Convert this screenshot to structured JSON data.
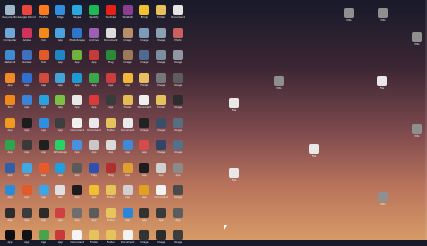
{
  "desktop": {
    "icons": [
      {
        "name": "Recycle Bin",
        "icon": "recycle-bin-icon",
        "color": "#9fb7c9"
      },
      {
        "name": "Google Chrome",
        "icon": "chrome-icon",
        "color": "#e8453c"
      },
      {
        "name": "Firefox",
        "icon": "firefox-icon",
        "color": "#ff7a1a"
      },
      {
        "name": "Edge",
        "icon": "edge-icon",
        "color": "#2f8ee0"
      },
      {
        "name": "Skype",
        "icon": "skype-icon",
        "color": "#29a8e0"
      },
      {
        "name": "Spotify",
        "icon": "spotify-icon",
        "color": "#1db954"
      },
      {
        "name": "YouTube",
        "icon": "youtube-icon",
        "color": "#e62117"
      },
      {
        "name": "WinRAR",
        "icon": "winrar-icon",
        "color": "#8b3d8f"
      },
      {
        "name": "Emoji",
        "icon": "emoji-icon",
        "color": "#f3c12e"
      },
      {
        "name": "Folder",
        "icon": "folder-icon",
        "color": "#e8c15a"
      },
      {
        "name": "Document",
        "icon": "document-icon",
        "color": "#e4e4e4"
      },
      {
        "name": "Computer",
        "icon": "computer-icon",
        "color": "#6fa7d6"
      },
      {
        "name": "Adobe",
        "icon": "adobe-icon",
        "color": "#d1345b"
      },
      {
        "name": "VLC",
        "icon": "vlc-icon",
        "color": "#f28a1a"
      },
      {
        "name": "App",
        "icon": "app-icon",
        "color": "#4aa3df"
      },
      {
        "name": "PhotoScape",
        "icon": "photo-icon",
        "color": "#2c77c9"
      },
      {
        "name": "Archive",
        "icon": "archive-icon",
        "color": "#9c5fb5"
      },
      {
        "name": "Document",
        "icon": "document-icon",
        "color": "#dcdcdc"
      },
      {
        "name": "Image",
        "icon": "image-icon",
        "color": "#b88d6a"
      },
      {
        "name": "Image",
        "icon": "image-icon",
        "color": "#7a9cb8"
      },
      {
        "name": "Image",
        "icon": "image-icon",
        "color": "#8ca0b3"
      },
      {
        "name": "Photo",
        "icon": "photo-icon",
        "color": "#c86060"
      },
      {
        "name": "Network",
        "icon": "network-icon",
        "color": "#3d8bd0"
      },
      {
        "name": "Games",
        "icon": "game-icon",
        "color": "#3f6fbf"
      },
      {
        "name": "Tool",
        "icon": "tool-icon",
        "color": "#e05a2a"
      },
      {
        "name": "App",
        "icon": "app-icon",
        "color": "#1e88c7"
      },
      {
        "name": "App",
        "icon": "app-icon",
        "color": "#70b33c"
      },
      {
        "name": "App",
        "icon": "app-icon",
        "color": "#c63a3a"
      },
      {
        "name": "Flag",
        "icon": "flag-icon",
        "color": "#2a8a3a"
      },
      {
        "name": "Image",
        "icon": "image-icon",
        "color": "#9b7a5a"
      },
      {
        "name": "Image",
        "icon": "image-icon",
        "color": "#4e6a8f"
      },
      {
        "name": "Image",
        "icon": "image-icon",
        "color": "#7b8f9e"
      },
      {
        "name": "Image",
        "icon": "image-icon",
        "color": "#8e97a2"
      },
      {
        "name": "App",
        "icon": "app-icon",
        "color": "#f08a24"
      },
      {
        "name": "App",
        "icon": "app-icon",
        "color": "#2f6fce"
      },
      {
        "name": "App",
        "icon": "app-icon",
        "color": "#d24a3b"
      },
      {
        "name": "App",
        "icon": "app-icon",
        "color": "#40a4d8"
      },
      {
        "name": "App",
        "icon": "app-icon",
        "color": "#1c9ad6"
      },
      {
        "name": "App",
        "icon": "app-icon",
        "color": "#3aa84a"
      },
      {
        "name": "App",
        "icon": "app-icon",
        "color": "#cc3d3d"
      },
      {
        "name": "App",
        "icon": "app-icon",
        "color": "#f1b83a"
      },
      {
        "name": "Folder",
        "icon": "folder-icon",
        "color": "#e6c060"
      },
      {
        "name": "Image",
        "icon": "image-icon",
        "color": "#777777"
      },
      {
        "name": "Image",
        "icon": "image-icon",
        "color": "#5d5d5d"
      },
      {
        "name": "Tool",
        "icon": "tool-icon",
        "color": "#ef8a18"
      },
      {
        "name": "App",
        "icon": "app-icon",
        "color": "#3a83d6"
      },
      {
        "name": "App",
        "icon": "app-icon",
        "color": "#27a1e0"
      },
      {
        "name": "App",
        "icon": "app-icon",
        "color": "#7ac043"
      },
      {
        "name": "App",
        "icon": "app-icon",
        "color": "#e8e8e8"
      },
      {
        "name": "App",
        "icon": "app-icon",
        "color": "#d93a3a"
      },
      {
        "name": "App",
        "icon": "app-icon",
        "color": "#3a3a3a"
      },
      {
        "name": "Folder",
        "icon": "folder-icon",
        "color": "#e2bd56"
      },
      {
        "name": "Document",
        "icon": "document-icon",
        "color": "#efefef"
      },
      {
        "name": "Folder",
        "icon": "folder-icon",
        "color": "#e4c35e"
      },
      {
        "name": "Image",
        "icon": "image-icon",
        "color": "#2c2c2c"
      },
      {
        "name": "App",
        "icon": "app-icon",
        "color": "#f09a1e"
      },
      {
        "name": "App",
        "icon": "app-icon",
        "color": "#1c1c1c"
      },
      {
        "name": "App",
        "icon": "app-icon",
        "color": "#2e8fe0"
      },
      {
        "name": "App",
        "icon": "app-icon",
        "color": "#3d3d3d"
      },
      {
        "name": "Document",
        "icon": "document-icon",
        "color": "#f0f0f0"
      },
      {
        "name": "Document",
        "icon": "document-icon",
        "color": "#e9e9e9"
      },
      {
        "name": "Folder",
        "icon": "folder-icon",
        "color": "#e5c25b"
      },
      {
        "name": "Document",
        "icon": "document-icon",
        "color": "#eaeaea"
      },
      {
        "name": "Image",
        "icon": "image-icon",
        "color": "#222222"
      },
      {
        "name": "Image",
        "icon": "image-icon",
        "color": "#3c4d66"
      },
      {
        "name": "Image",
        "icon": "image-icon",
        "color": "#5a6d80"
      },
      {
        "name": "App",
        "icon": "app-icon",
        "color": "#2ba64a"
      },
      {
        "name": "App",
        "icon": "app-icon",
        "color": "#3a3a3a"
      },
      {
        "name": "App",
        "icon": "app-icon",
        "color": "#1f1f1f"
      },
      {
        "name": "WhatsApp",
        "icon": "whatsapp-icon",
        "color": "#25d366"
      },
      {
        "name": "App",
        "icon": "app-icon",
        "color": "#4a8fe0"
      },
      {
        "name": "App",
        "icon": "app-icon",
        "color": "#c8c8c8"
      },
      {
        "name": "App",
        "icon": "app-icon",
        "color": "#dadada"
      },
      {
        "name": "App",
        "icon": "app-icon",
        "color": "#3f89d6"
      },
      {
        "name": "App",
        "icon": "app-icon",
        "color": "#d64a4a"
      },
      {
        "name": "Image",
        "icon": "image-icon",
        "color": "#334466"
      },
      {
        "name": "Image",
        "icon": "image-icon",
        "color": "#56708a"
      },
      {
        "name": "App",
        "icon": "app-icon",
        "color": "#2f5fa8"
      },
      {
        "name": "App",
        "icon": "app-icon",
        "color": "#3fa9e6"
      },
      {
        "name": "App",
        "icon": "app-icon",
        "color": "#e85a2a"
      },
      {
        "name": "App",
        "icon": "app-icon",
        "color": "#1ea0e0"
      },
      {
        "name": "App",
        "icon": "app-icon",
        "color": "#5a5a5a"
      },
      {
        "name": "Flag",
        "icon": "flag-icon",
        "color": "#3050b0"
      },
      {
        "name": "Flag",
        "icon": "flag-icon",
        "color": "#b03030"
      },
      {
        "name": "App",
        "icon": "app-icon",
        "color": "#e0a030"
      },
      {
        "name": "App",
        "icon": "app-icon",
        "color": "#1d1d1d"
      },
      {
        "name": "App",
        "icon": "app-icon",
        "color": "#d0d0d0"
      },
      {
        "name": "App",
        "icon": "app-icon",
        "color": "#8a8a8a"
      },
      {
        "name": "App",
        "icon": "app-icon",
        "color": "#2a8bd8"
      },
      {
        "name": "App",
        "icon": "app-icon",
        "color": "#e25a2a"
      },
      {
        "name": "App",
        "icon": "app-icon",
        "color": "#3aa6e8"
      },
      {
        "name": "App",
        "icon": "app-icon",
        "color": "#e0e0e0"
      },
      {
        "name": "App",
        "icon": "app-icon",
        "color": "#1c1c1c"
      },
      {
        "name": "App",
        "icon": "app-icon",
        "color": "#f0c030"
      },
      {
        "name": "Folder",
        "icon": "folder-icon",
        "color": "#e8c35a"
      },
      {
        "name": "App",
        "icon": "app-icon",
        "color": "#cfcfcf"
      },
      {
        "name": "App",
        "icon": "app-icon",
        "color": "#e0a020"
      },
      {
        "name": "Document",
        "icon": "document-icon",
        "color": "#f2f2f2"
      },
      {
        "name": "Image",
        "icon": "image-icon",
        "color": "#4a4a4a"
      },
      {
        "name": "App",
        "icon": "app-icon",
        "color": "#2d2d2d"
      },
      {
        "name": "App",
        "icon": "app-icon",
        "color": "#3c3c3c"
      },
      {
        "name": "App",
        "icon": "app-icon",
        "color": "#2a2a2a"
      },
      {
        "name": "App",
        "icon": "app-icon",
        "color": "#d04040"
      },
      {
        "name": "App",
        "icon": "app-icon",
        "color": "#6e6e6e"
      },
      {
        "name": "App",
        "icon": "app-icon",
        "color": "#5b5b5b"
      },
      {
        "name": "Folder",
        "icon": "folder-icon",
        "color": "#e7c45c"
      },
      {
        "name": "App",
        "icon": "app-icon",
        "color": "#2a86d8"
      },
      {
        "name": "App",
        "icon": "app-icon",
        "color": "#333333"
      },
      {
        "name": "App",
        "icon": "app-icon",
        "color": "#3a3a3a"
      },
      {
        "name": "App",
        "icon": "app-icon",
        "color": "#5c5c5c"
      },
      {
        "name": "App",
        "icon": "app-icon",
        "color": "#0f0f0f"
      },
      {
        "name": "App",
        "icon": "app-icon",
        "color": "#121212"
      },
      {
        "name": "App",
        "icon": "app-icon",
        "color": "#4aa34a"
      },
      {
        "name": "App",
        "icon": "app-icon",
        "color": "#c83a3a"
      },
      {
        "name": "Document",
        "icon": "document-icon",
        "color": "#f4f4f4"
      },
      {
        "name": "Folder",
        "icon": "folder-icon",
        "color": "#e6c25b"
      },
      {
        "name": "Folder",
        "icon": "folder-icon",
        "color": "#e6c25b"
      },
      {
        "name": "Document",
        "icon": "document-icon",
        "color": "#f2f2f2"
      },
      {
        "name": "Image",
        "icon": "image-icon",
        "color": "#333333"
      },
      {
        "name": "Image",
        "icon": "image-icon",
        "color": "#2c2c2c"
      },
      {
        "name": "Image",
        "icon": "image-icon",
        "color": "#3d3d3d"
      }
    ],
    "scattered": [
      {
        "name": "IMG",
        "icon": "image-icon",
        "color": "#8f8f8f"
      },
      {
        "name": "IMG",
        "icon": "image-icon",
        "color": "#8f8f8f"
      },
      {
        "name": "IMG",
        "icon": "image-icon",
        "color": "#8f8f8f"
      },
      {
        "name": "IMG",
        "icon": "image-icon",
        "color": "#8f8f8f"
      },
      {
        "name": "File",
        "icon": "document-icon",
        "color": "#e8e8e8"
      },
      {
        "name": "File",
        "icon": "document-icon",
        "color": "#e8e8e8"
      },
      {
        "name": "IMG",
        "icon": "image-icon",
        "color": "#8f8f8f"
      },
      {
        "name": "File",
        "icon": "document-icon",
        "color": "#e8e8e8"
      },
      {
        "name": "File",
        "icon": "document-icon",
        "color": "#e8e8e8"
      },
      {
        "name": "IMG",
        "icon": "image-icon",
        "color": "#8f8f8f"
      }
    ]
  }
}
